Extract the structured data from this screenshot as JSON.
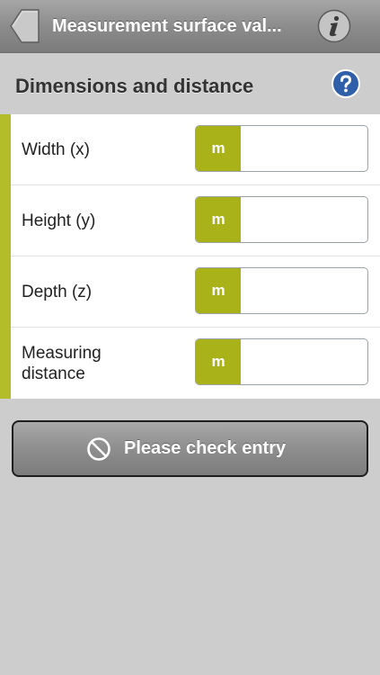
{
  "header": {
    "title": "Measurement surface val...",
    "back_icon": "back-arrow-icon",
    "info_icon": "info-icon"
  },
  "section": {
    "title": "Dimensions and distance",
    "help_icon": "question-mark-icon"
  },
  "fields": [
    {
      "label": "Width (x)",
      "unit": "m",
      "value": ""
    },
    {
      "label": "Height (y)",
      "unit": "m",
      "value": ""
    },
    {
      "label": "Depth (z)",
      "unit": "m",
      "value": ""
    },
    {
      "label": "Measuring distance",
      "unit": "m",
      "value": ""
    }
  ],
  "action": {
    "label": "Please check entry",
    "icon": "no-entry-icon"
  },
  "colors": {
    "accent": "#b3bd2a",
    "unit_badge": "#aab21a",
    "help_blue": "#2f5fa8",
    "background": "#cdcdcd"
  }
}
